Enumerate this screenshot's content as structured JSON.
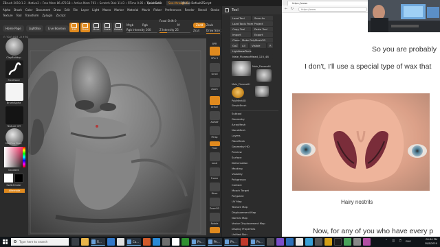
{
  "zbrush": {
    "title": "ZBrush 2019.1.2 - Native2 • Free Mem 86.472GB • Active Mem 791 • Scratch Disk 1143 • RTime 0.85 • Timer 0.00",
    "quicksave": "QuickSave",
    "seethrough": "See-through 0",
    "title_menus": "Menus   DefaultZScript",
    "menu_row1": [
      "Alpha",
      "Brush",
      "Color",
      "Document",
      "Draw",
      "Edit",
      "File",
      "Layer",
      "Light",
      "Macro",
      "Marker",
      "Material",
      "Movie",
      "Picker",
      "Preferences",
      "Render",
      "Stencil",
      "Stroke"
    ],
    "menu_row2": [
      "Texture",
      "Tool",
      "Transform",
      "Zplugin",
      "Zscript"
    ],
    "home_page": "Home Page",
    "lightbox": "LightBox",
    "live_boolean": "Live Boolean",
    "shelf_buttons": [
      "Edit",
      "Draw",
      "Move",
      "Scale",
      "Rotate"
    ],
    "mrgb": "Mrgb",
    "rgb": "Rgb",
    "m": "M",
    "zadd": "Zadd",
    "zsub": "Zsub",
    "zcut": "Zcut",
    "focal_shift": "Focal Shift 0",
    "draw_size": "Draw Size 2",
    "z_intensity": "Z Intensity 25",
    "rgb_intensity": "Rgb Intensity 100",
    "coords": "0.19,0.091,-0.458",
    "left_tiles": [
      "ClayBuildup",
      "FreeHand",
      "BrushAlpha",
      "Texture Off",
      "MatCap Gray"
    ],
    "gradient": "Gradient",
    "switch_color": "SwitchColor",
    "alternate": "Alternate",
    "right_buttons": [
      "BPR",
      "SPix 3",
      "Scroll",
      "Zoom",
      "Actual",
      "AAHalf",
      "Persp",
      "Floor",
      "Local",
      "Frame",
      "Move",
      "Zoom3D",
      "Rotate",
      "Line Fill PolyF",
      "Transp",
      "Solo"
    ],
    "tool": {
      "header": "Tool",
      "load_tool": "Load Tool",
      "save_as": "Save As",
      "load_from_project": "Load Tools From Project",
      "copy_tool": "Copy Tool",
      "paste_tool": "Paste Tool",
      "import": "Import",
      "export": "Export",
      "clone": "Clone",
      "make_polymesh": "Make PolyMesh3D",
      "goz": "GoZ",
      "all": "All",
      "visible": "Visible",
      "r": "R",
      "lightbox_tools": "Lightbox▸Tools",
      "current_tool": "Male_PlanesofHead_125_48",
      "thumb_labels": [
        "Male_PlanesofH",
        "Male_PlanesofH",
        "PolyMesh3D",
        "SimpleBrush",
        "Male_PlanesofH"
      ],
      "subpalettes": [
        "Subtool",
        "Geometry",
        "ArrayMesh",
        "NanoMesh",
        "Layers",
        "FiberMesh",
        "Geometry HD",
        "Preview",
        "Surface",
        "Deformation",
        "Masking",
        "Visibility",
        "Polygroups",
        "Contact",
        "Morph Target",
        "Polypaint",
        "UV Map",
        "Texture Map",
        "Displacement Map",
        "Normal Map",
        "Vector Displacement Map",
        "Display Properties",
        "Unified Skin",
        "Initialize",
        "Import",
        "Export"
      ]
    }
  },
  "browser": {
    "tab": "https://www.",
    "url": "https://www.",
    "lines": [
      "So you are probably",
      "I don't, I'll use a special type of wax that",
      "Now, for any of you who have every p"
    ],
    "caption": "Hairy nostrils"
  },
  "taskbar": {
    "search_placeholder": "Type here to search",
    "apps": [
      "Fi...",
      "Ca...",
      "Ph...",
      "Ph...",
      "Ph...",
      "Ph..."
    ],
    "time": "09:34 PM",
    "date": "10/8/2020",
    "lang": "ENG"
  },
  "colors": {
    "accent": "#e08a1e",
    "zbrush_bg": "#2b2b2b",
    "canvas": "#505050",
    "taskbar": "#101418"
  }
}
